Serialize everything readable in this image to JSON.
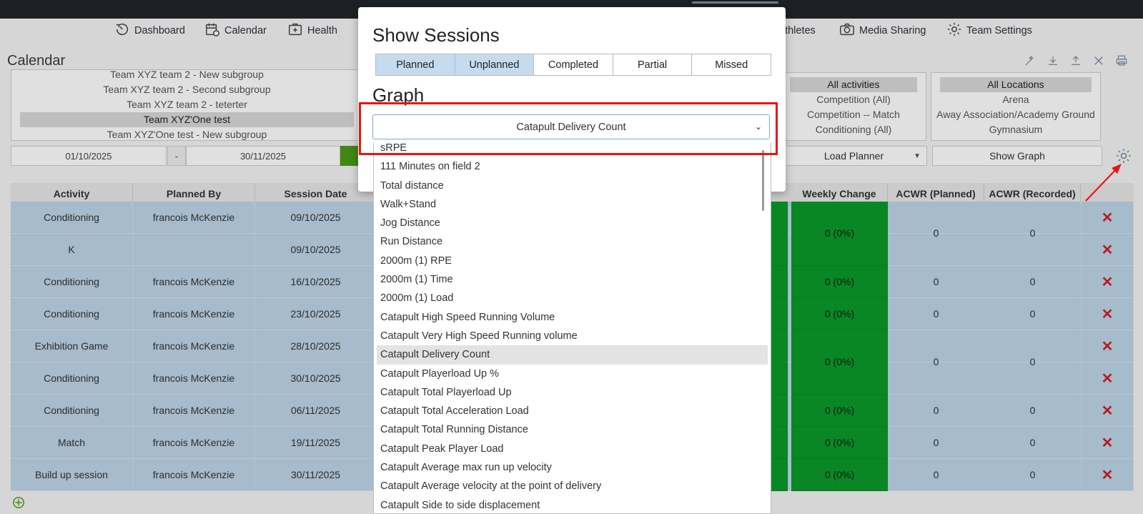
{
  "nav": {
    "items": [
      {
        "label": "Dashboard",
        "icon": "dashboard-icon"
      },
      {
        "label": "Calendar",
        "icon": "calendar-icon"
      },
      {
        "label": "Health",
        "icon": "health-icon"
      },
      {
        "label": "athletes",
        "icon": "athletes-icon"
      },
      {
        "label": "Media Sharing",
        "icon": "camera-icon"
      },
      {
        "label": "Team Settings",
        "icon": "gear-icon"
      }
    ]
  },
  "calendar": {
    "title": "Calendar",
    "groups": [
      "Team XYZ team 2 - New subgroup",
      "Team XYZ team 2 - Second subgroup",
      "Team XYZ team 2 - teterter",
      "Team XYZ'One test",
      "Team XYZ'One test - New subgroup"
    ],
    "activities": [
      "All activities",
      "Competition (All)",
      "Competition -- Match",
      "Conditioning (All)"
    ],
    "locations": [
      "All Locations",
      "Arena",
      "Away Association/Academy Ground",
      "Gymnasium"
    ],
    "date_from": "01/10/2025",
    "date_sep": "-",
    "date_to": "30/11/2025",
    "view_select": "Load Planner",
    "show_graph_label": "Show Graph"
  },
  "table": {
    "headers": {
      "activity": "Activity",
      "planned_by": "Planned By",
      "session_date": "Session Date",
      "weekly_change": "Weekly Change",
      "acwr_planned": "ACWR (Planned)",
      "acwr_recorded": "ACWR (Recorded)"
    },
    "rows": [
      {
        "activity": "Conditioning",
        "planned_by": "francois McKenzie",
        "date": "09/10/2025"
      },
      {
        "activity": "K",
        "planned_by": "",
        "date": "09/10/2025"
      },
      {
        "activity": "Conditioning",
        "planned_by": "francois McKenzie",
        "date": "16/10/2025"
      },
      {
        "activity": "Conditioning",
        "planned_by": "francois McKenzie",
        "date": "23/10/2025"
      },
      {
        "activity": "Exhibition Game",
        "planned_by": "francois McKenzie",
        "date": "28/10/2025"
      },
      {
        "activity": "Conditioning",
        "planned_by": "francois McKenzie",
        "date": "30/10/2025"
      },
      {
        "activity": "Conditioning",
        "planned_by": "francois McKenzie",
        "date": "06/11/2025"
      },
      {
        "activity": "Match",
        "planned_by": "francois McKenzie",
        "date": "19/11/2025"
      },
      {
        "activity": "Build up session",
        "planned_by": "francois McKenzie",
        "date": "30/11/2025"
      }
    ],
    "weekly_groups": [
      {
        "change": "0 (0%)",
        "acwr_planned": "0",
        "acwr_recorded": "0"
      },
      {
        "change": "0 (0%)",
        "acwr_planned": "0",
        "acwr_recorded": "0"
      },
      {
        "change": "0 (0%)",
        "acwr_planned": "0",
        "acwr_recorded": "0"
      },
      {
        "change": "0 (0%)",
        "acwr_planned": "0",
        "acwr_recorded": "0"
      },
      {
        "change": "0 (0%)",
        "acwr_planned": "0",
        "acwr_recorded": "0"
      },
      {
        "change": "0 (0%)",
        "acwr_planned": "0",
        "acwr_recorded": "0"
      },
      {
        "change": "0 (0%)",
        "acwr_planned": "0",
        "acwr_recorded": "0"
      }
    ],
    "delete_glyph": "✕"
  },
  "modal": {
    "title": "Show Sessions",
    "segments": [
      {
        "label": "Planned",
        "active": true
      },
      {
        "label": "Unplanned",
        "active": true
      },
      {
        "label": "Completed",
        "active": false
      },
      {
        "label": "Partial",
        "active": false
      },
      {
        "label": "Missed",
        "active": false
      }
    ],
    "graph_title": "Graph",
    "graph_selected": "Catapult Delivery Count",
    "options": [
      "sRPE",
      "111 Minutes on field 2",
      "Total distance",
      "Walk+Stand",
      "Jog Distance",
      "Run Distance",
      "2000m (1) RPE",
      "2000m (1) Time",
      "2000m (1) Load",
      "Catapult High Speed Running Volume",
      "Catapult Very High Speed Running volume",
      "Catapult Delivery Count",
      "Catapult Playerload Up %",
      "Catapult Total Playerload Up",
      "Catapult Total Acceleration Load",
      "Catapult Total Running Distance",
      "Catapult Peak Player Load",
      "Catapult Average max run up velocity",
      "Catapult Average velocity at the point of delivery",
      "Catapult Side to side displacement"
    ]
  },
  "colors": {
    "topbar": "#22262b",
    "row_blue": "#bed5e8",
    "load_green": "#0a9a2a",
    "segment_active": "#c5dcf0",
    "annotation_red": "#e81515",
    "delete_red": "#d42020"
  }
}
